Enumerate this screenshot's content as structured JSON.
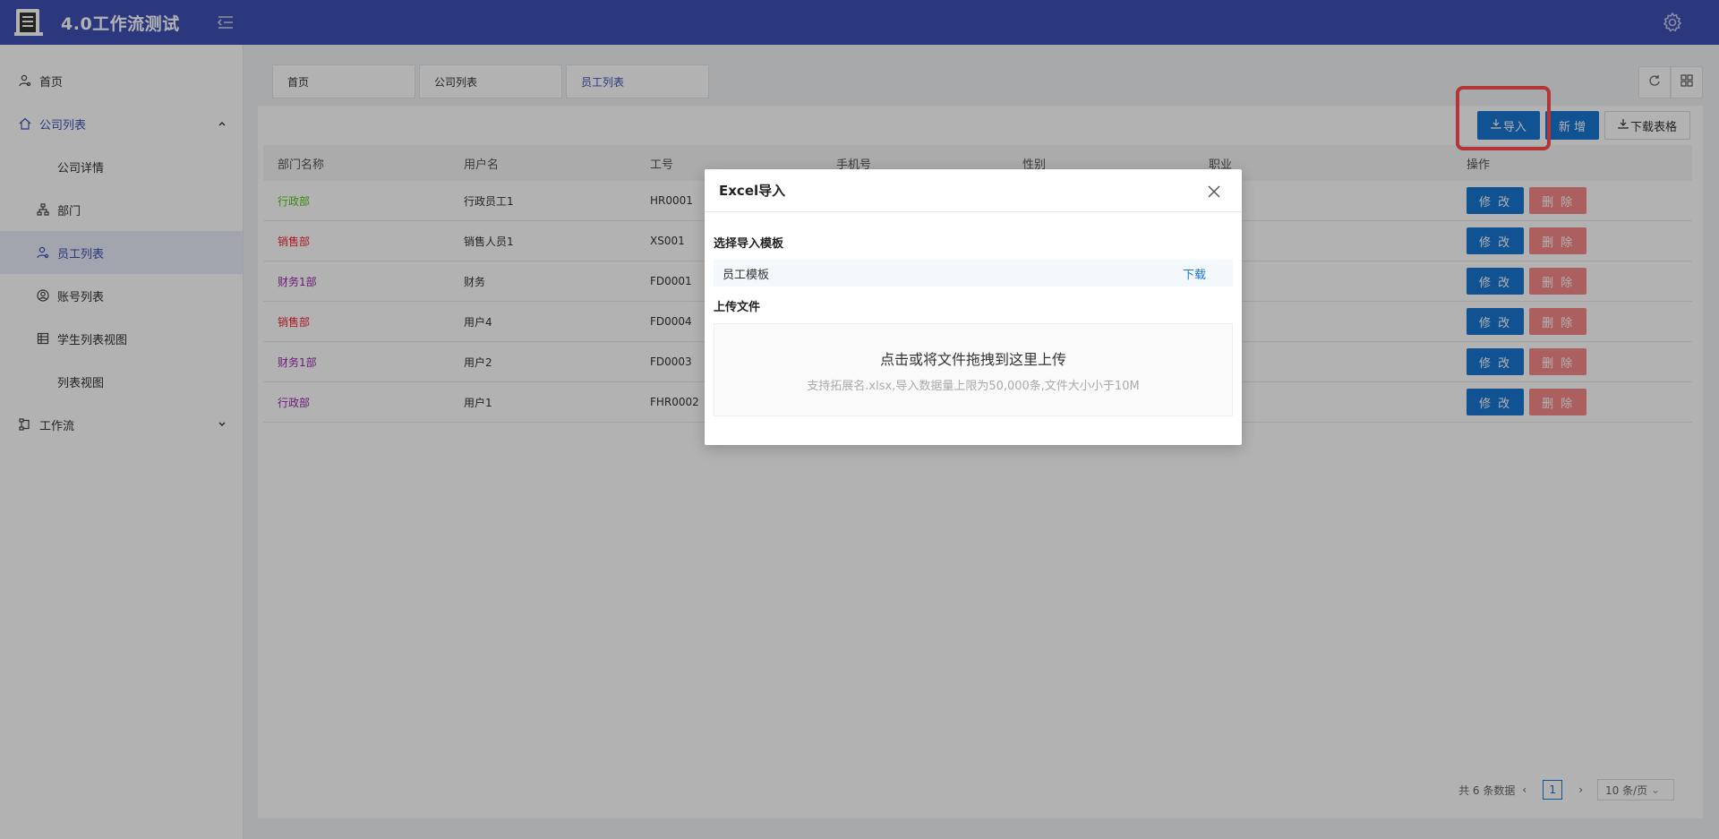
{
  "header": {
    "title": "4.0工作流测试"
  },
  "sidebar": {
    "items": [
      {
        "label": "首页"
      },
      {
        "label": "公司列表"
      },
      {
        "label": "公司详情"
      },
      {
        "label": "部门"
      },
      {
        "label": "员工列表"
      },
      {
        "label": "账号列表"
      },
      {
        "label": "学生列表视图"
      },
      {
        "label": "列表视图"
      },
      {
        "label": "工作流"
      }
    ]
  },
  "tabs": [
    {
      "label": "首页"
    },
    {
      "label": "公司列表"
    },
    {
      "label": "员工列表"
    }
  ],
  "toolbar": {
    "import_label": "导入",
    "add_label": "新 增",
    "download_label": "下载表格"
  },
  "table": {
    "columns": [
      "部门名称",
      "用户名",
      "工号",
      "手机号",
      "性别",
      "职业",
      "操作"
    ],
    "rows": [
      {
        "dept": "行政部",
        "dept_color": "#52c41a",
        "user": "行政员工1",
        "id": "HR0001"
      },
      {
        "dept": "销售部",
        "dept_color": "#f5222d",
        "user": "销售人员1",
        "id": "XS001"
      },
      {
        "dept": "财务1部",
        "dept_color": "#9c27b0",
        "user": "财务",
        "id": "FD0001"
      },
      {
        "dept": "销售部",
        "dept_color": "#f5222d",
        "user": "用户4",
        "id": "FD0004"
      },
      {
        "dept": "财务1部",
        "dept_color": "#9c27b0",
        "user": "用户2",
        "id": "FD0003"
      },
      {
        "dept": "行政部",
        "dept_color": "#9c27b0",
        "user": "用户1",
        "id": "FHR0002"
      }
    ],
    "edit_label": "修 改",
    "delete_label": "删 除"
  },
  "pager": {
    "total": "共 6 条数据",
    "page": "1",
    "size": "10 条/页"
  },
  "modal": {
    "title": "Excel导入",
    "template_section": "选择导入模板",
    "template_name": "员工模板",
    "template_link": "下载",
    "upload_section": "上传文件",
    "dropzone_title": "点击或将文件拖拽到这里上传",
    "dropzone_hint": "支持拓展名.xlsx,导入数据量上限为50,000条,文件大小小于10M"
  },
  "colors": {
    "header_bg": "#3f51b5",
    "primary": "#1976d2",
    "danger": "#f56c6c",
    "highlight": "#ff4d4f"
  }
}
